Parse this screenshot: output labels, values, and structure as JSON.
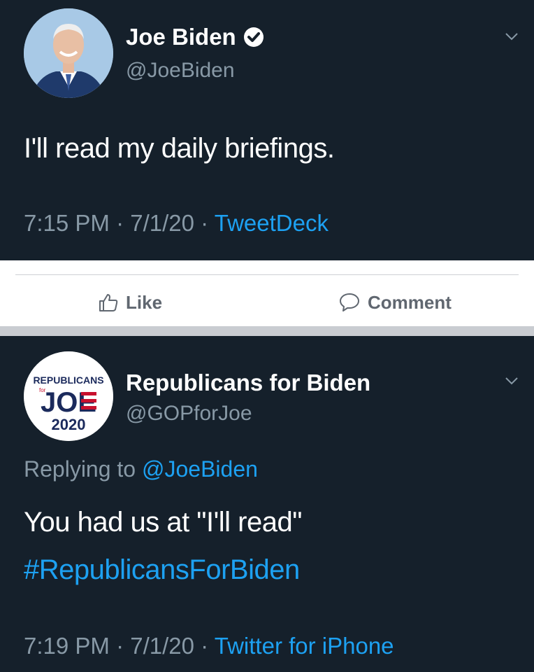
{
  "tweet1": {
    "author_name": "Joe Biden",
    "author_handle": "@JoeBiden",
    "text": "I'll read my daily briefings.",
    "time": "7:15 PM",
    "date": "7/1/20",
    "source": "TweetDeck",
    "separator": "·"
  },
  "facebook_bar": {
    "like_label": "Like",
    "comment_label": "Comment"
  },
  "tweet2": {
    "author_name": "Republicans for Biden",
    "author_handle": "@GOPforJoe",
    "replying_prefix": "Replying to",
    "replying_mention": "@JoeBiden",
    "text": "You had us at \"I'll read\"",
    "hashtag": "#RepublicansForBiden",
    "time": "7:19 PM",
    "date": "7/1/20",
    "source": "Twitter for iPhone",
    "separator": "·",
    "logo": {
      "top_text": "REPUBLICANS",
      "small_text": "for",
      "main_text": "JOE",
      "year": "2020"
    }
  },
  "colors": {
    "background": "#15202b",
    "link_blue": "#1da1f2",
    "secondary_text": "#8899a6",
    "fb_bar": "#ffffff",
    "fb_text": "#606770"
  }
}
